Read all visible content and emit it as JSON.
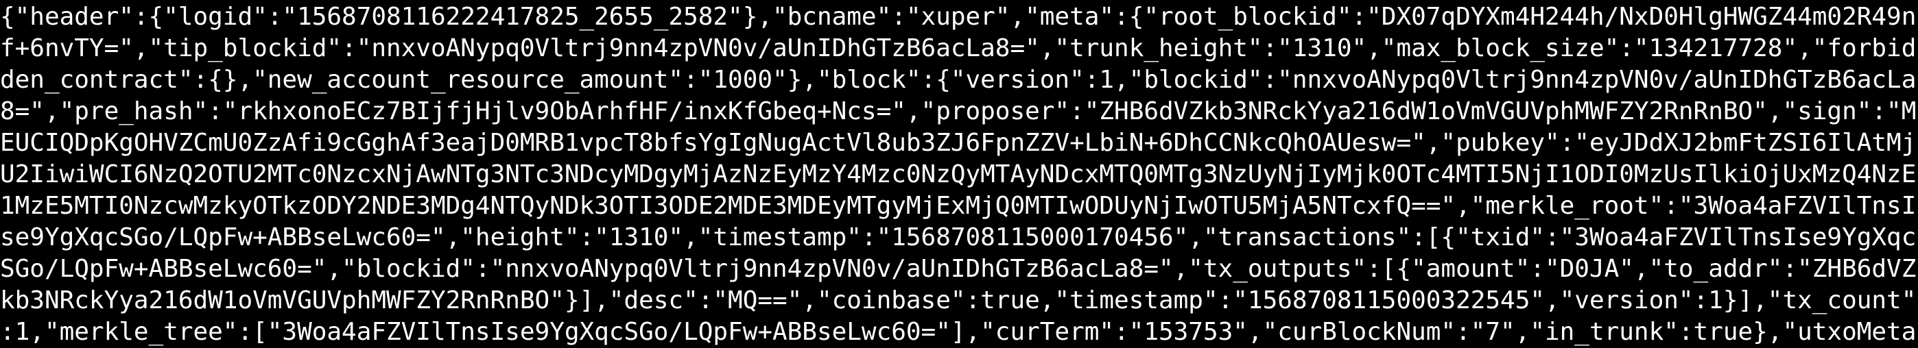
{
  "terminal": {
    "background": "#000000",
    "foreground": "#ffffff",
    "lines": [
      "{\"header\":{\"logid\":\"1568708116222417825_2655_2582\"},\"bcname\":\"xuper\",\"meta\":{\"root_blockid\":\"DX07qDYXm4H244h/NxD0HlgHWGZ44m02R49n",
      "f+6nvTY=\",\"tip_blockid\":\"nnxvoANypq0Vltrj9nn4zpVN0v/aUnIDhGTzB6acLa8=\",\"trunk_height\":\"1310\",\"max_block_size\":\"134217728\",\"forbid",
      "den_contract\":{},\"new_account_resource_amount\":\"1000\"},\"block\":{\"version\":1,\"blockid\":\"nnxvoANypq0Vltrj9nn4zpVN0v/aUnIDhGTzB6acLa",
      "8=\",\"pre_hash\":\"rkhxonoECz7BIjfjHjlv9ObArhfHF/inxKfGbeq+Ncs=\",\"proposer\":\"ZHB6dVZkb3NRckYya216dW1oVmVGUVphMWFZY2RnRnBO\",\"sign\":\"M",
      "EUCIQDpKgOHVZCmU0ZzAfi9cGghAf3eajD0MRB1vpcT8bfsYgIgNugActVl8ub3ZJ6FpnZZV+LbiN+6DhCCNkcQhOAUesw=\",\"pubkey\":\"eyJDdXJ2bmFtZSI6IlAtMj",
      "U2IiwiWCI6NzQ2OTU2MTc0NzcxNjAwNTg3NTc3NDcyMDgyMjAzNzEyMzY4Mzc0NzQyMTAyNDcxMTQ0MTg3NzUyNjIyMjk0OTc4MTI5NjI1ODI0MzUsIlkiOjUxMzQ4NzE",
      "1MzE5MTI0NzcwMzkyOTkzODY2NDE3MDg4NTQyNDk3OTI3ODE2MDE3MDEyMTgyMjExMjQ0MTIwODUyNjIwOTU5MjA5NTcxfQ==\",\"merkle_root\":\"3Woa4aFZVIlTnsI",
      "se9YgXqcSGo/LQpFw+ABBseLwc60=\",\"height\":\"1310\",\"timestamp\":\"1568708115000170456\",\"transactions\":[{\"txid\":\"3Woa4aFZVIlTnsIse9YgXqc",
      "SGo/LQpFw+ABBseLwc60=\",\"blockid\":\"nnxvoANypq0Vltrj9nn4zpVN0v/aUnIDhGTzB6acLa8=\",\"tx_outputs\":[{\"amount\":\"D0JA\",\"to_addr\":\"ZHB6dVZ",
      "kb3NRckYya216dW1oVmVGUVphMWFZY2RnRnBO\"}],\"desc\":\"MQ==\",\"coinbase\":true,\"timestamp\":\"1568708115000322545\",\"version\":1}],\"tx_count\"",
      ":1,\"merkle_tree\":[\"3Woa4aFZVIlTnsIse9YgXqcSGo/LQpFw+ABBseLwc60=\"],\"curTerm\":\"153753\",\"curBlockNum\":\"7\",\"in_trunk\":true},\"utxoMeta"
    ]
  }
}
